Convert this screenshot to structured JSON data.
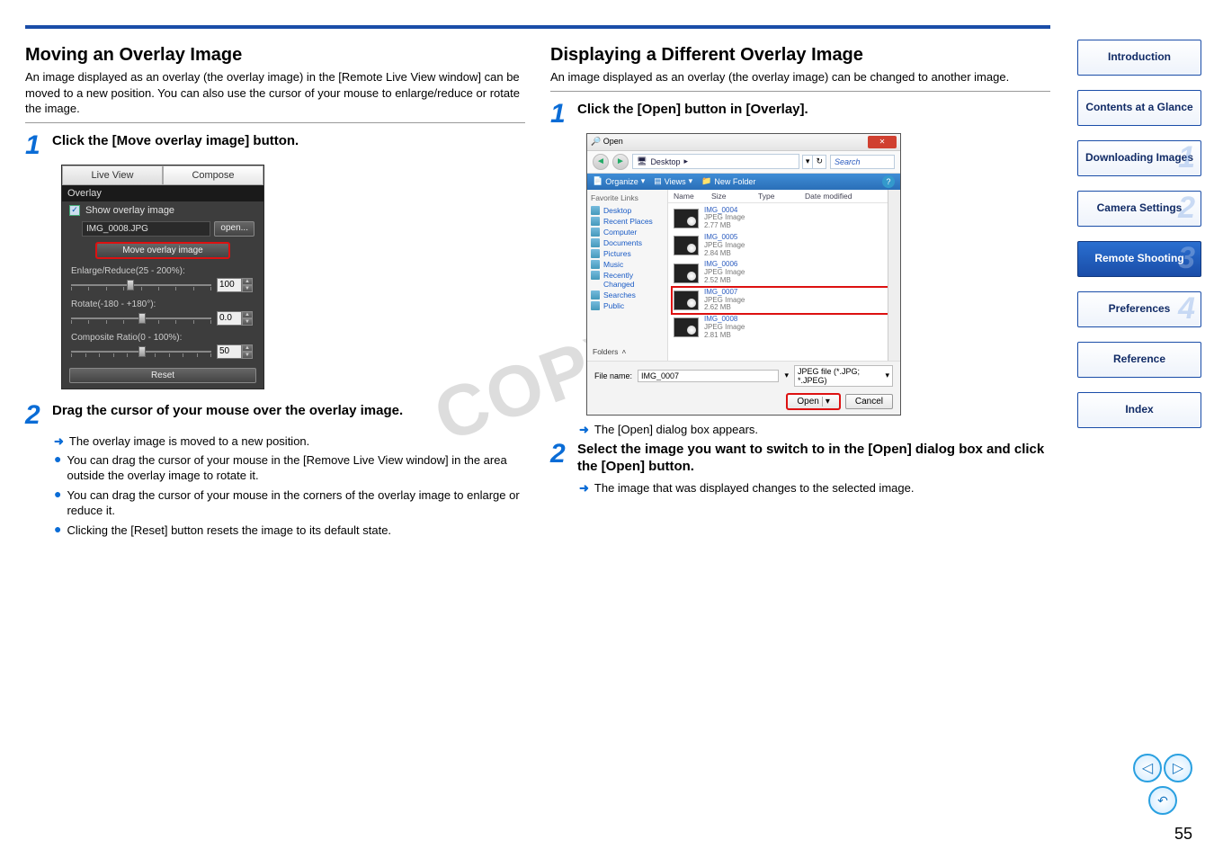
{
  "left": {
    "heading": "Moving an Overlay Image",
    "intro": "An image displayed as an overlay (the overlay image) in the [Remote Live View window] can be moved to a new position. You can also use the cursor of your mouse to enlarge/reduce or rotate the image.",
    "step1": "Click the [Move overlay image] button.",
    "step2": "Drag the cursor of your mouse over the overlay image.",
    "arrow1": "The overlay image is moved to a new position.",
    "b1": "You can drag the cursor of your mouse in the [Remove Live View window] in the area outside the overlay image to rotate it.",
    "b2": "You can drag the cursor of your mouse in the corners of the overlay image to enlarge or reduce it.",
    "b3": "Clicking the [Reset] button resets the image to its default state."
  },
  "panel": {
    "tab_live": "Live View",
    "tab_compose": "Compose",
    "section": "Overlay",
    "show_overlay": "Show overlay image",
    "filename": "IMG_0008.JPG",
    "open": "open...",
    "move_btn": "Move overlay image",
    "enlarge_label": "Enlarge/Reduce(25 - 200%):",
    "enlarge_val": "100",
    "rotate_label": "Rotate(-180 - +180°):",
    "rotate_val": "0.0",
    "ratio_label": "Composite Ratio(0 - 100%):",
    "ratio_val": "50",
    "reset": "Reset"
  },
  "right": {
    "heading": "Displaying a Different Overlay Image",
    "intro": "An image displayed as an overlay (the overlay image) can be changed to another image.",
    "step1": "Click the [Open] button in [Overlay].",
    "arrow1": "The [Open] dialog box appears.",
    "step2": "Select the image you want to switch to in the [Open] dialog box and click the [Open] button.",
    "arrow2": "The image that was displayed changes to the selected image."
  },
  "dialog": {
    "title": "Open",
    "crumb": "Desktop",
    "search": "Search",
    "organize": "Organize",
    "views": "Views",
    "newfolder": "New Folder",
    "fav_hdr": "Favorite Links",
    "links": [
      "Desktop",
      "Recent Places",
      "Computer",
      "Documents",
      "Pictures",
      "Music",
      "Recently Changed",
      "Searches",
      "Public"
    ],
    "folders": "Folders",
    "col_name": "Name",
    "col_size": "Size",
    "col_type": "Type",
    "col_date": "Date modified",
    "files": [
      {
        "name": "IMG_0004",
        "type": "JPEG Image",
        "size": "2.77 MB"
      },
      {
        "name": "IMG_0005",
        "type": "JPEG Image",
        "size": "2.84 MB"
      },
      {
        "name": "IMG_0006",
        "type": "JPEG Image",
        "size": "2.52 MB"
      },
      {
        "name": "IMG_0007",
        "type": "JPEG Image",
        "size": "2.62 MB"
      },
      {
        "name": "IMG_0008",
        "type": "JPEG Image",
        "size": "2.81 MB"
      }
    ],
    "fname_label": "File name:",
    "fname_value": "IMG_0007",
    "filetype": "JPEG file (*.JPG; *.JPEG)",
    "open_btn": "Open",
    "cancel_btn": "Cancel"
  },
  "nav": {
    "intro": "Introduction",
    "contents": "Contents at a Glance",
    "downloading": "Downloading Images",
    "camera": "Camera Settings",
    "remote": "Remote Shooting",
    "prefs": "Preferences",
    "reference": "Reference",
    "index": "Index"
  },
  "watermark": "COPY",
  "page_number": "55"
}
